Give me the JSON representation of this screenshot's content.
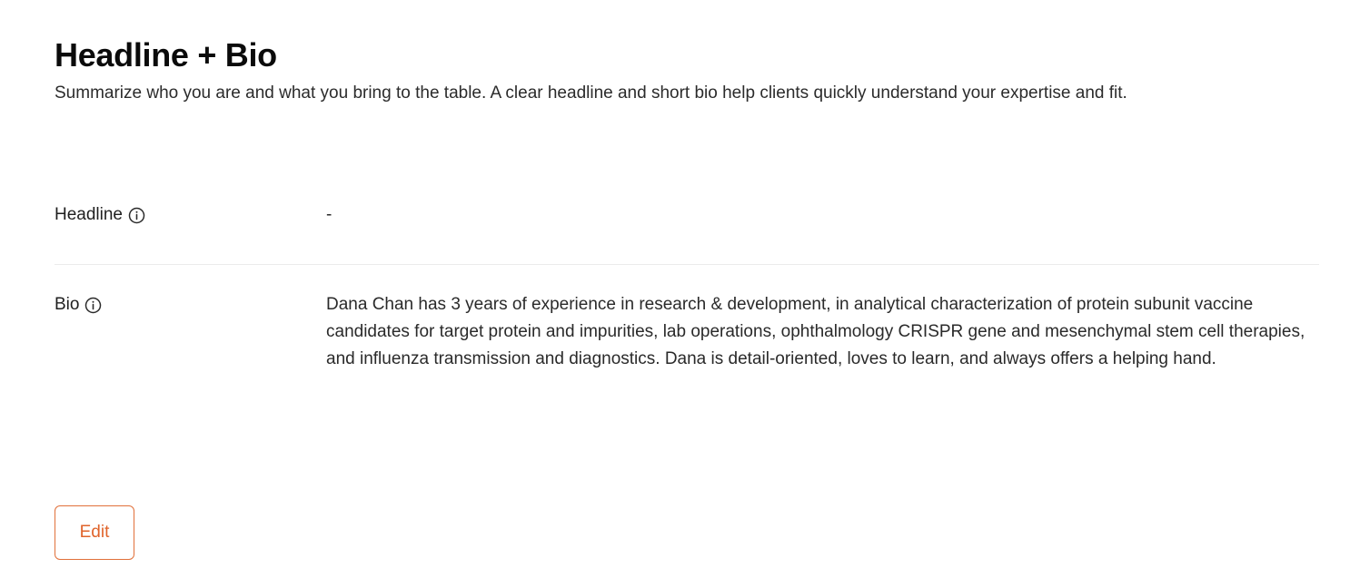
{
  "section": {
    "title": "Headline + Bio",
    "subtitle": "Summarize who you are and what you bring to the table. A clear headline and short bio help clients quickly understand your expertise and fit."
  },
  "fields": {
    "headline": {
      "label": "Headline",
      "icon": "info-icon",
      "value": "-"
    },
    "bio": {
      "label": "Bio",
      "icon": "info-icon",
      "value": "Dana Chan has 3 years of experience in research & development, in analytical characterization of protein subunit vaccine candidates for target protein and impurities, lab operations, ophthalmology CRISPR gene and mesenchymal stem cell therapies, and influenza transmission and diagnostics. Dana is detail-oriented, loves to learn, and always offers a helping hand."
    }
  },
  "actions": {
    "edit_label": "Edit"
  },
  "colors": {
    "accent": "#e0642b",
    "divider": "#ebebeb",
    "text": "#1f1f1f"
  }
}
